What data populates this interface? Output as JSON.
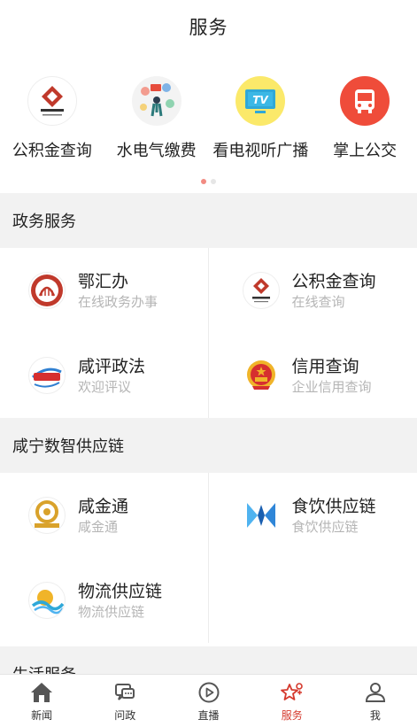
{
  "header": {
    "title": "服务"
  },
  "quick": {
    "items": [
      {
        "label": "公积金查询",
        "icon": "housing-fund-logo-icon"
      },
      {
        "label": "水电气缴费",
        "icon": "utility-payment-icon"
      },
      {
        "label": "看电视听广播",
        "icon": "tv-icon"
      },
      {
        "label": "掌上公交",
        "icon": "bus-icon"
      }
    ],
    "active_page": 1,
    "page_count": 2
  },
  "sections": [
    {
      "title": "政务服务",
      "items": [
        {
          "title": "鄂汇办",
          "sub": "在线政务办事",
          "icon": "ehuiban-logo-icon"
        },
        {
          "title": "公积金查询",
          "sub": "在线查询",
          "icon": "housing-fund-logo-icon"
        },
        {
          "title": "咸评政法",
          "sub": "欢迎评议",
          "icon": "xianping-logo-icon"
        },
        {
          "title": "信用查询",
          "sub": "企业信用查询",
          "icon": "national-emblem-icon"
        }
      ]
    },
    {
      "title": "咸宁数智供应链",
      "items": [
        {
          "title": "咸金通",
          "sub": "咸金通",
          "icon": "xianjintong-logo-icon"
        },
        {
          "title": "食饮供应链",
          "sub": "食饮供应链",
          "icon": "food-supply-logo-icon"
        },
        {
          "title": "物流供应链",
          "sub": "物流供应链",
          "icon": "logistics-logo-icon"
        }
      ]
    },
    {
      "title": "生活服务"
    }
  ],
  "tabbar": {
    "tabs": [
      {
        "label": "新闻",
        "icon": "home-icon"
      },
      {
        "label": "问政",
        "icon": "chat-icon"
      },
      {
        "label": "直播",
        "icon": "play-icon"
      },
      {
        "label": "服务",
        "icon": "star-service-icon",
        "active": true
      },
      {
        "label": "我",
        "icon": "user-icon"
      }
    ]
  },
  "colors": {
    "accent": "#d53a2e",
    "section_bg": "#f2f2f2",
    "subtext": "#b5b5b5"
  }
}
